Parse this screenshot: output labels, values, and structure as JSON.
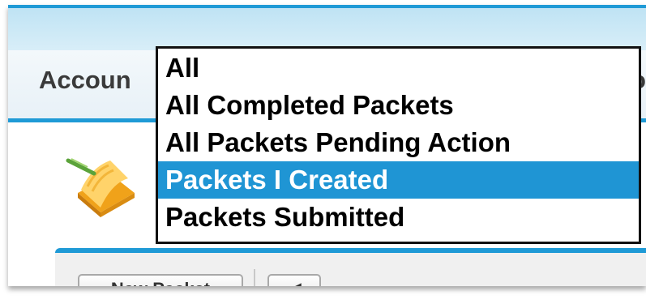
{
  "tabs": {
    "active_label": "Accoun",
    "right_fragment": "o"
  },
  "buttons": {
    "new_packet": "New Packet",
    "nav_arrow": "◀"
  },
  "dropdown": {
    "selected_index": 3,
    "options": [
      {
        "label": "All"
      },
      {
        "label": "All Completed Packets"
      },
      {
        "label": "All Packets Pending Action"
      },
      {
        "label": "Packets I Created"
      },
      {
        "label": "Packets Submitted"
      }
    ]
  },
  "colors": {
    "accent": "#1f9ad6",
    "selection": "#1f95d4"
  }
}
